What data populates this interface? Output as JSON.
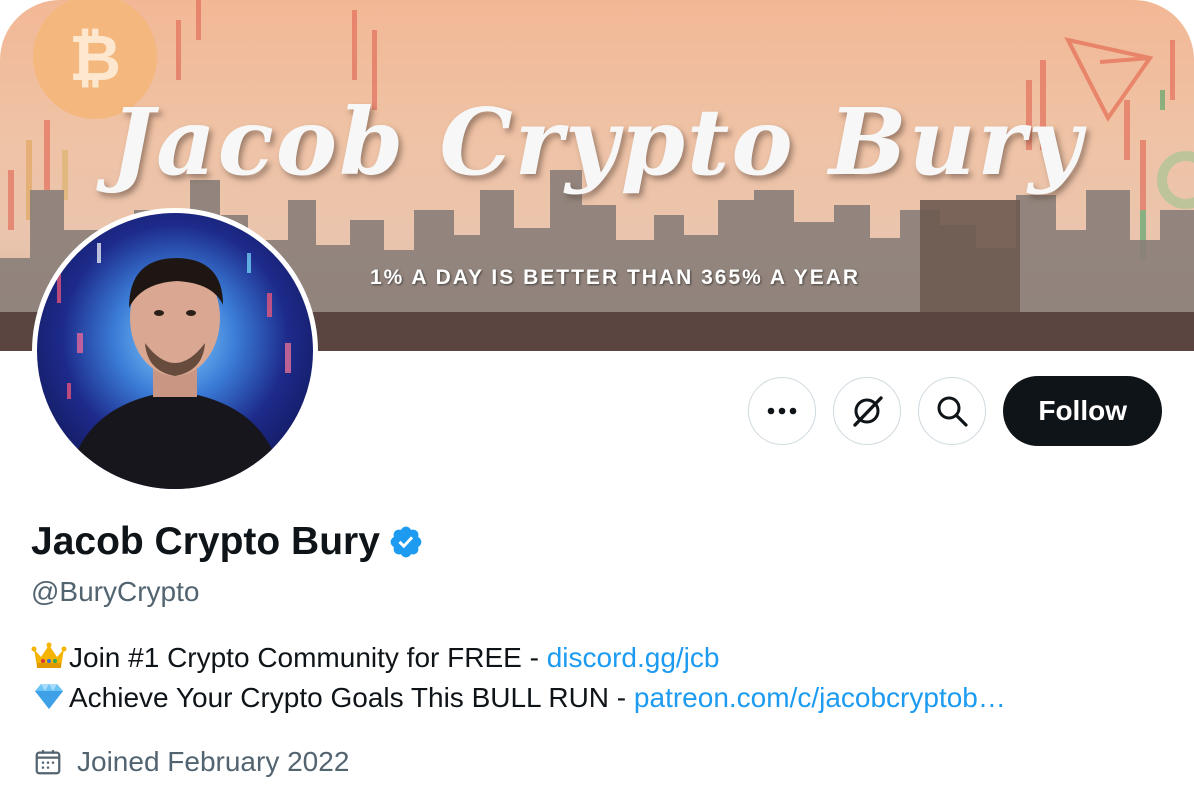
{
  "banner": {
    "title": "Jacob Crypto Bury",
    "tagline": "1% A DAY IS BETTER THAN 365% A YEAR",
    "btc_icon": "bitcoin-icon",
    "trx_icon": "tron-icon"
  },
  "actions": {
    "more_icon": "more-icon",
    "grok_icon": "grok-icon",
    "search_icon": "search-icon",
    "follow_label": "Follow"
  },
  "profile": {
    "name": "Jacob Crypto Bury",
    "verified_icon": "verified-badge-icon",
    "handle": "@BuryCrypto",
    "bio": [
      {
        "emoji": "crown-emoji",
        "text": "Join #1 Crypto Community for FREE - ",
        "link": "discord.gg/jcb"
      },
      {
        "emoji": "gem-emoji",
        "text": "Achieve Your Crypto Goals This BULL RUN  - ",
        "link": "patreon.com/c/jacobcryptob…"
      }
    ],
    "joined_icon": "calendar-icon",
    "joined": "Joined February 2022"
  },
  "colors": {
    "link": "#1d9bf0",
    "verified": "#1d9bf0",
    "follow_bg": "#0f1419",
    "secondary_text": "#536471"
  }
}
